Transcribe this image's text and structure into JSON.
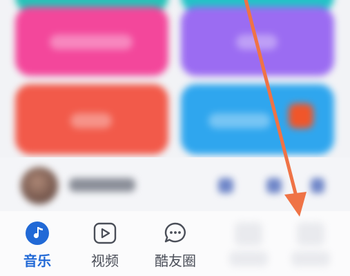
{
  "tabs": [
    {
      "label": "音乐",
      "icon": "music-note-icon",
      "active": true
    },
    {
      "label": "视频",
      "icon": "video-play-icon",
      "active": false
    },
    {
      "label": "酷友圈",
      "icon": "chat-bubble-icon",
      "active": false
    }
  ],
  "colors": {
    "accent": "#2169d6",
    "pink_tile": "#f3479b",
    "purple_tile": "#9b6cf2",
    "red_tile": "#f25a4a",
    "blue_tile": "#2fa6ee",
    "arrow": "#ef7346"
  }
}
